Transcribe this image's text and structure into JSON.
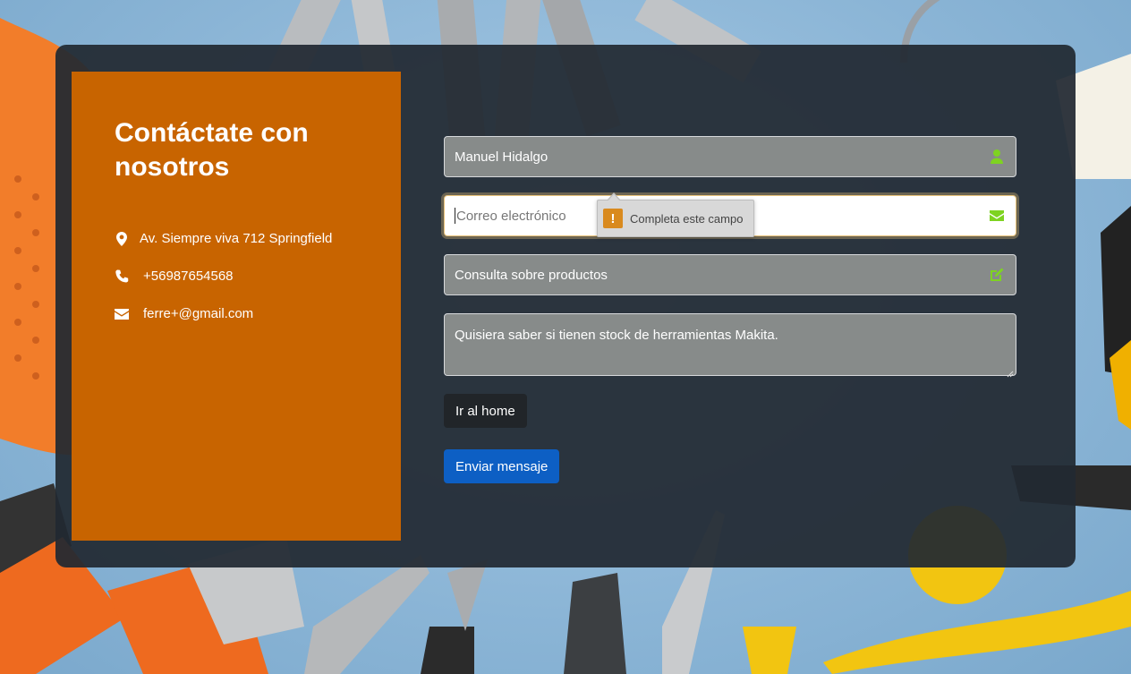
{
  "contact_panel": {
    "title": "Contáctate con nosotros",
    "address": "Av. Siempre viva 712 Springfield",
    "phone": "+56987654568",
    "email": "ferre+@gmail.com"
  },
  "form": {
    "name_value": "Manuel Hidalgo",
    "email_placeholder": "Correo electrónico",
    "subject_value": "Consulta sobre productos",
    "message_value": "Quisiera saber si tienen stock de herramientas Makita.",
    "home_button": "Ir al home",
    "send_button": "Enviar mensaje"
  },
  "validation_tooltip": {
    "message": "Completa este campo"
  },
  "icons": {
    "name_field": "user-icon",
    "email_field": "envelope-icon",
    "subject_field": "edit-icon"
  },
  "colors": {
    "panel_orange": "#c86400",
    "field_icon_green": "#7ed321",
    "send_button_blue": "#0d5fc4",
    "home_button_dark": "#212529"
  }
}
